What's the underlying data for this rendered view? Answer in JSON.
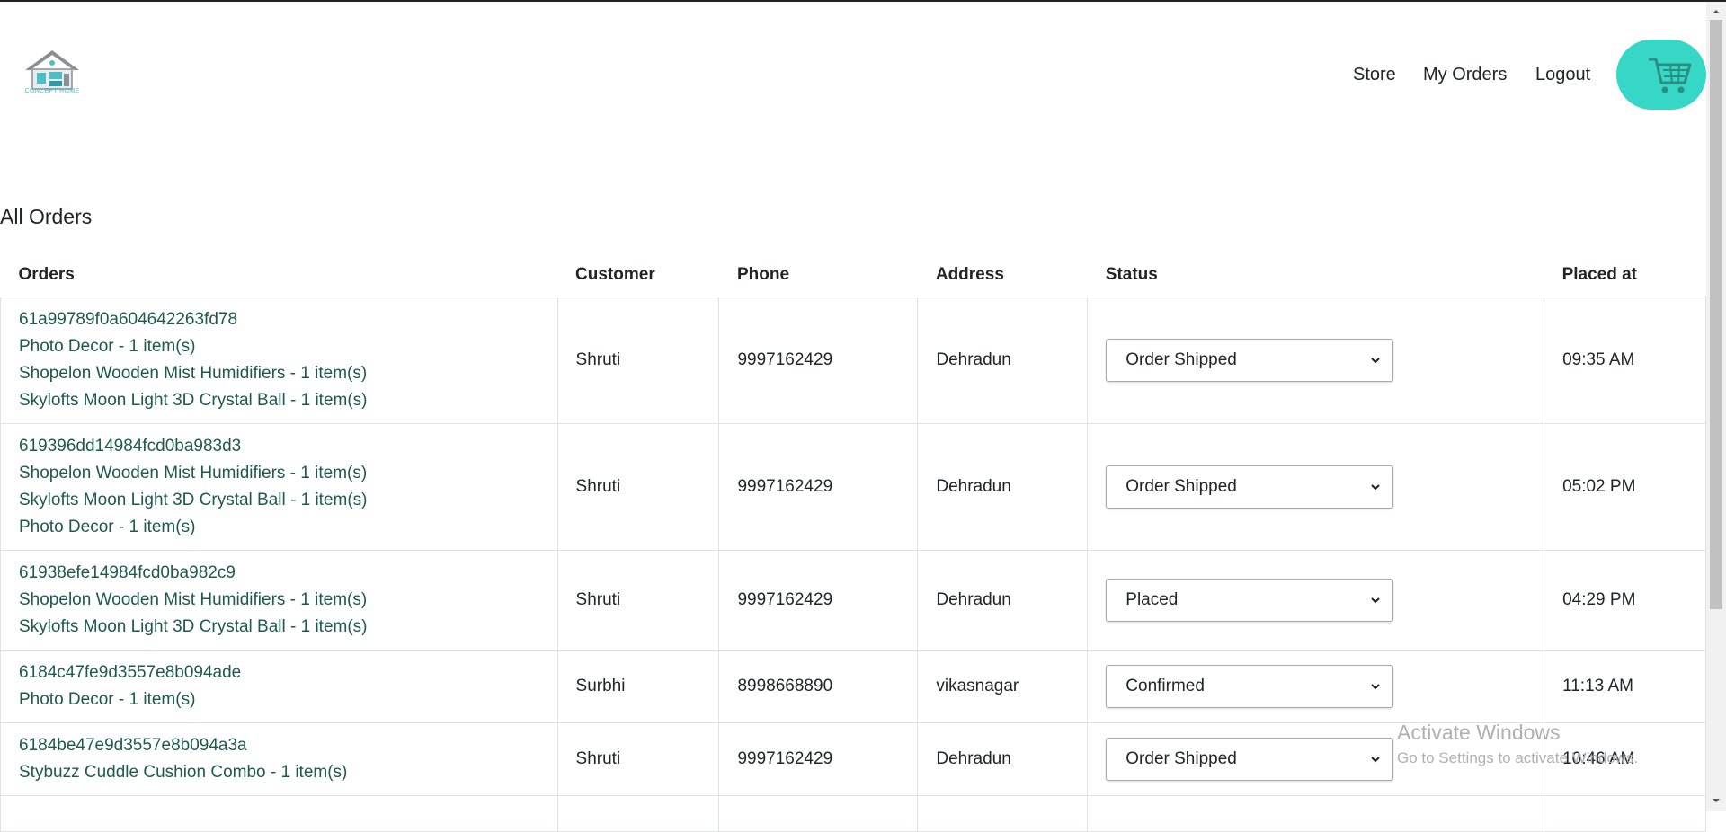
{
  "brand": {
    "logo_text": "CONCEPT HOME",
    "accent": "#36d7c7"
  },
  "nav": {
    "store": "Store",
    "my_orders": "My Orders",
    "logout": "Logout",
    "cart_icon": "cart-icon"
  },
  "page": {
    "title": "All Orders"
  },
  "table": {
    "headers": {
      "orders": "Orders",
      "customer": "Customer",
      "phone": "Phone",
      "address": "Address",
      "status": "Status",
      "placed_at": "Placed at"
    },
    "rows": [
      {
        "id": "61a99789f0a604642263fd78",
        "items": [
          "Photo Decor - 1 item(s)",
          "Shopelon Wooden Mist Humidifiers - 1 item(s)",
          "Skylofts Moon Light 3D Crystal Ball - 1 item(s)"
        ],
        "customer": "Shruti",
        "phone": "9997162429",
        "address": "Dehradun",
        "status": "Order Shipped",
        "placed_at": "09:35 AM"
      },
      {
        "id": "619396dd14984fcd0ba983d3",
        "items": [
          "Shopelon Wooden Mist Humidifiers - 1 item(s)",
          "Skylofts Moon Light 3D Crystal Ball - 1 item(s)",
          "Photo Decor - 1 item(s)"
        ],
        "customer": "Shruti",
        "phone": "9997162429",
        "address": "Dehradun",
        "status": "Order Shipped",
        "placed_at": "05:02 PM"
      },
      {
        "id": "61938efe14984fcd0ba982c9",
        "items": [
          "Shopelon Wooden Mist Humidifiers - 1 item(s)",
          "Skylofts Moon Light 3D Crystal Ball - 1 item(s)"
        ],
        "customer": "Shruti",
        "phone": "9997162429",
        "address": "Dehradun",
        "status": "Placed",
        "placed_at": "04:29 PM"
      },
      {
        "id": "6184c47fe9d3557e8b094ade",
        "items": [
          "Photo Decor - 1 item(s)"
        ],
        "customer": "Surbhi",
        "phone": "8998668890",
        "address": "vikasnagar",
        "status": "Confirmed",
        "placed_at": "11:13 AM"
      },
      {
        "id": "6184be47e9d3557e8b094a3a",
        "items": [
          "Stybuzz Cuddle Cushion Combo - 1 item(s)"
        ],
        "customer": "Shruti",
        "phone": "9997162429",
        "address": "Dehradun",
        "status": "Order Shipped",
        "placed_at": "10:46 AM"
      }
    ]
  },
  "watermark": {
    "title": "Activate Windows",
    "subtitle": "Go to Settings to activate Windows."
  }
}
